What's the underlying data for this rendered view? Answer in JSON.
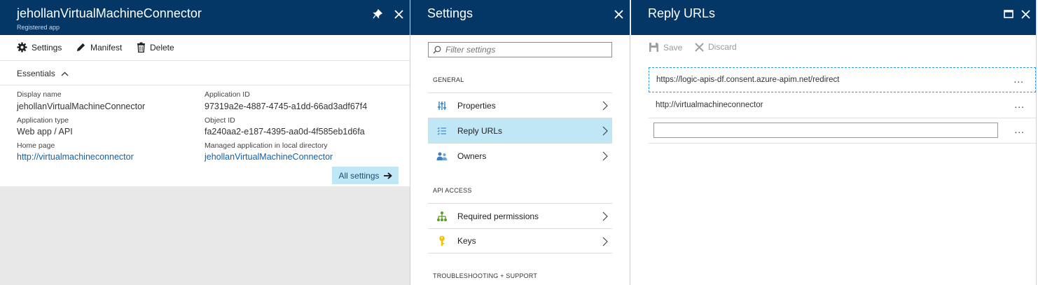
{
  "app_blade": {
    "title": "jehollanVirtualMachineConnector",
    "subtitle": "Registered app",
    "commands": {
      "settings": "Settings",
      "manifest": "Manifest",
      "delete": "Delete"
    },
    "essentials_label": "Essentials",
    "fields": {
      "display_name_label": "Display name",
      "display_name": "jehollanVirtualMachineConnector",
      "app_type_label": "Application type",
      "app_type": "Web app / API",
      "home_page_label": "Home page",
      "home_page": "http://virtualmachineconnector",
      "app_id_label": "Application ID",
      "app_id": "97319a2e-4887-4745-a1dd-66ad3adf67f4",
      "object_id_label": "Object ID",
      "object_id": "fa240aa2-e187-4395-aa0d-4f585eb1d6fa",
      "managed_app_label": "Managed application in local directory",
      "managed_app": "jehollanVirtualMachineConnector"
    },
    "all_settings": "All settings"
  },
  "settings_blade": {
    "title": "Settings",
    "search_placeholder": "Filter settings",
    "sections": {
      "general": "GENERAL",
      "api_access": "API ACCESS",
      "troubleshooting": "TROUBLESHOOTING + SUPPORT"
    },
    "items": {
      "properties": "Properties",
      "reply_urls": "Reply URLs",
      "owners": "Owners",
      "required_permissions": "Required permissions",
      "keys": "Keys"
    }
  },
  "reply_blade": {
    "title": "Reply URLs",
    "save": "Save",
    "discard": "Discard",
    "urls": [
      "https://logic-apis-df.consent.azure-apim.net/redirect",
      "http://virtualmachineconnector"
    ],
    "new_url_value": "",
    "more": "..."
  },
  "colors": {
    "header": "#043766",
    "selected": "#bfe7f6",
    "link": "#0f62b0",
    "active_tab": "#ff8c00"
  }
}
